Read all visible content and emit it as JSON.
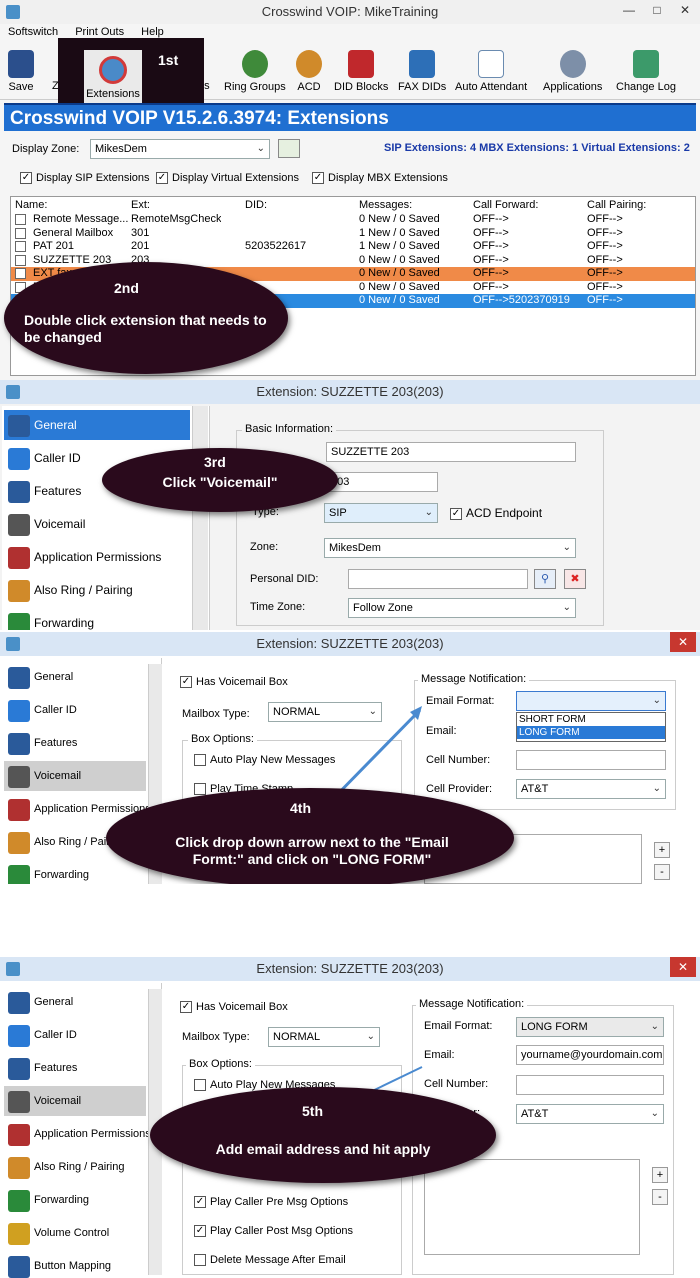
{
  "panel1": {
    "title": "Crosswind VOIP: MikeTraining",
    "menu": [
      "Softswitch",
      "Print Outs",
      "Help"
    ],
    "toolbar": {
      "save": "Save",
      "extensions": "Extensions",
      "ring_groups": "Ring Groups",
      "acd": "ACD",
      "did_blocks": "DID Blocks",
      "fax_dids": "FAX DIDs",
      "auto_attendant": "Auto Attendant",
      "applications": "Applications",
      "change_log": "Change Log",
      "partial_left": "Z",
      "partial_right": "ns"
    },
    "banner": "Crosswind VOIP V15.2.6.3974: Extensions",
    "display_zone_label": "Display Zone:",
    "display_zone_value": "MikesDem",
    "counts": "SIP Extensions: 4  MBX Extensions: 1  Virtual Extensions: 2",
    "checks": [
      "Display SIP Extensions",
      "Display Virtual Extensions",
      "Display MBX Extensions"
    ],
    "columns": [
      "Name:",
      "Ext:",
      "DID:",
      "Messages:",
      "Call Forward:",
      "Call Pairing:"
    ],
    "rows": [
      {
        "name": "Remote Message...",
        "ext": "RemoteMsgCheck",
        "did": "",
        "messages": "0 New / 0 Saved",
        "forward": "OFF-->",
        "pairing": "OFF-->"
      },
      {
        "name": "General Mailbox",
        "ext": "301",
        "did": "",
        "messages": "1 New / 0 Saved",
        "forward": "OFF-->",
        "pairing": "OFF-->"
      },
      {
        "name": "PAT 201",
        "ext": "201",
        "did": "5203522617",
        "messages": "1 New / 0 Saved",
        "forward": "OFF-->",
        "pairing": "OFF-->"
      },
      {
        "name": "SUZZETTE 203",
        "ext": "203",
        "did": "",
        "messages": "0 New / 0 Saved",
        "forward": "OFF-->",
        "pairing": "OFF-->"
      },
      {
        "name": "EXT fax",
        "ext": "f...",
        "did": "",
        "messages": "0 New / 0 Saved",
        "forward": "OFF-->",
        "pairing": "OFF-->"
      },
      {
        "name": "EXT...",
        "ext": "",
        "did": "",
        "messages": "0 New / 0 Saved",
        "forward": "OFF-->",
        "pairing": "OFF-->"
      },
      {
        "name": "",
        "ext": "",
        "did": "",
        "messages": "0 New / 0 Saved",
        "forward": "OFF-->5202370919",
        "pairing": "OFF-->"
      }
    ],
    "step1": "1st",
    "step2": "2nd",
    "step2_text": "Double click extension that needs to be changed"
  },
  "panel2": {
    "title": "Extension: SUZZETTE 203(203)",
    "sidebar": [
      "General",
      "Caller ID",
      "Features",
      "Voicemail",
      "Application Permissions",
      "Also Ring / Pairing",
      "Forwarding"
    ],
    "group_title": "Basic Information:",
    "name_value": "SUZZETTE 203",
    "ext_value": "203",
    "type_label": "Type:",
    "type_value": "SIP",
    "acd_label": "ACD Endpoint",
    "zone_label": "Zone:",
    "zone_value": "MikesDem",
    "personal_did_label": "Personal DID:",
    "time_zone_label": "Time Zone:",
    "time_zone_value": "Follow Zone",
    "step3": "3rd",
    "step3_text": "Click  \"Voicemail\""
  },
  "panel3": {
    "title": "Extension: SUZZETTE 203(203)",
    "sidebar": [
      "General",
      "Caller ID",
      "Features",
      "Voicemail",
      "Application Permissions",
      "Also Ring / Pairing",
      "Forwarding"
    ],
    "has_vm": "Has Voicemail Box",
    "mailbox_type_label": "Mailbox Type:",
    "mailbox_type_value": "NORMAL",
    "box_options": "Box Options:",
    "auto_play": "Auto Play New Messages",
    "play_time": "Play Time Stamp",
    "msg_notification": "Message Notification:",
    "email_format_label": "Email Format:",
    "email_label": "Email:",
    "cell_number_label": "Cell Number:",
    "cell_provider_label": "Cell Provider:",
    "cell_provider_value": "AT&T",
    "dropdown_options": [
      "SHORT FORM",
      "LONG FORM"
    ],
    "step4": "4th",
    "step4_text": "Click  drop down arrow next to the  \"Email Formt:\" and click on   \"LONG FORM\""
  },
  "panel4": {
    "title": "Extension: SUZZETTE 203(203)",
    "sidebar": [
      "General",
      "Caller ID",
      "Features",
      "Voicemail",
      "Application Permissions",
      "Also Ring / Pairing",
      "Forwarding",
      "Volume Control",
      "Button Mapping"
    ],
    "has_vm": "Has Voicemail Box",
    "mailbox_type_label": "Mailbox Type:",
    "mailbox_type_value": "NORMAL",
    "box_options": "Box Options:",
    "auto_play": "Auto Play New Messages",
    "pre_msg": "Play Caller Pre Msg Options",
    "post_msg": "Play Caller Post Msg Options",
    "delete_msg": "Delete Message After Email",
    "msg_notification": "Message Notification:",
    "email_format_label": "Email Format:",
    "email_format_value": "LONG FORM",
    "email_label": "Email:",
    "email_value": "yourname@yourdomain.com",
    "cell_number_label": "Cell Number:",
    "cell_provider_label": "Provider:",
    "cell_provider_value": "AT&T",
    "step5": "5th",
    "step5_text": "Add email address and hit apply"
  }
}
